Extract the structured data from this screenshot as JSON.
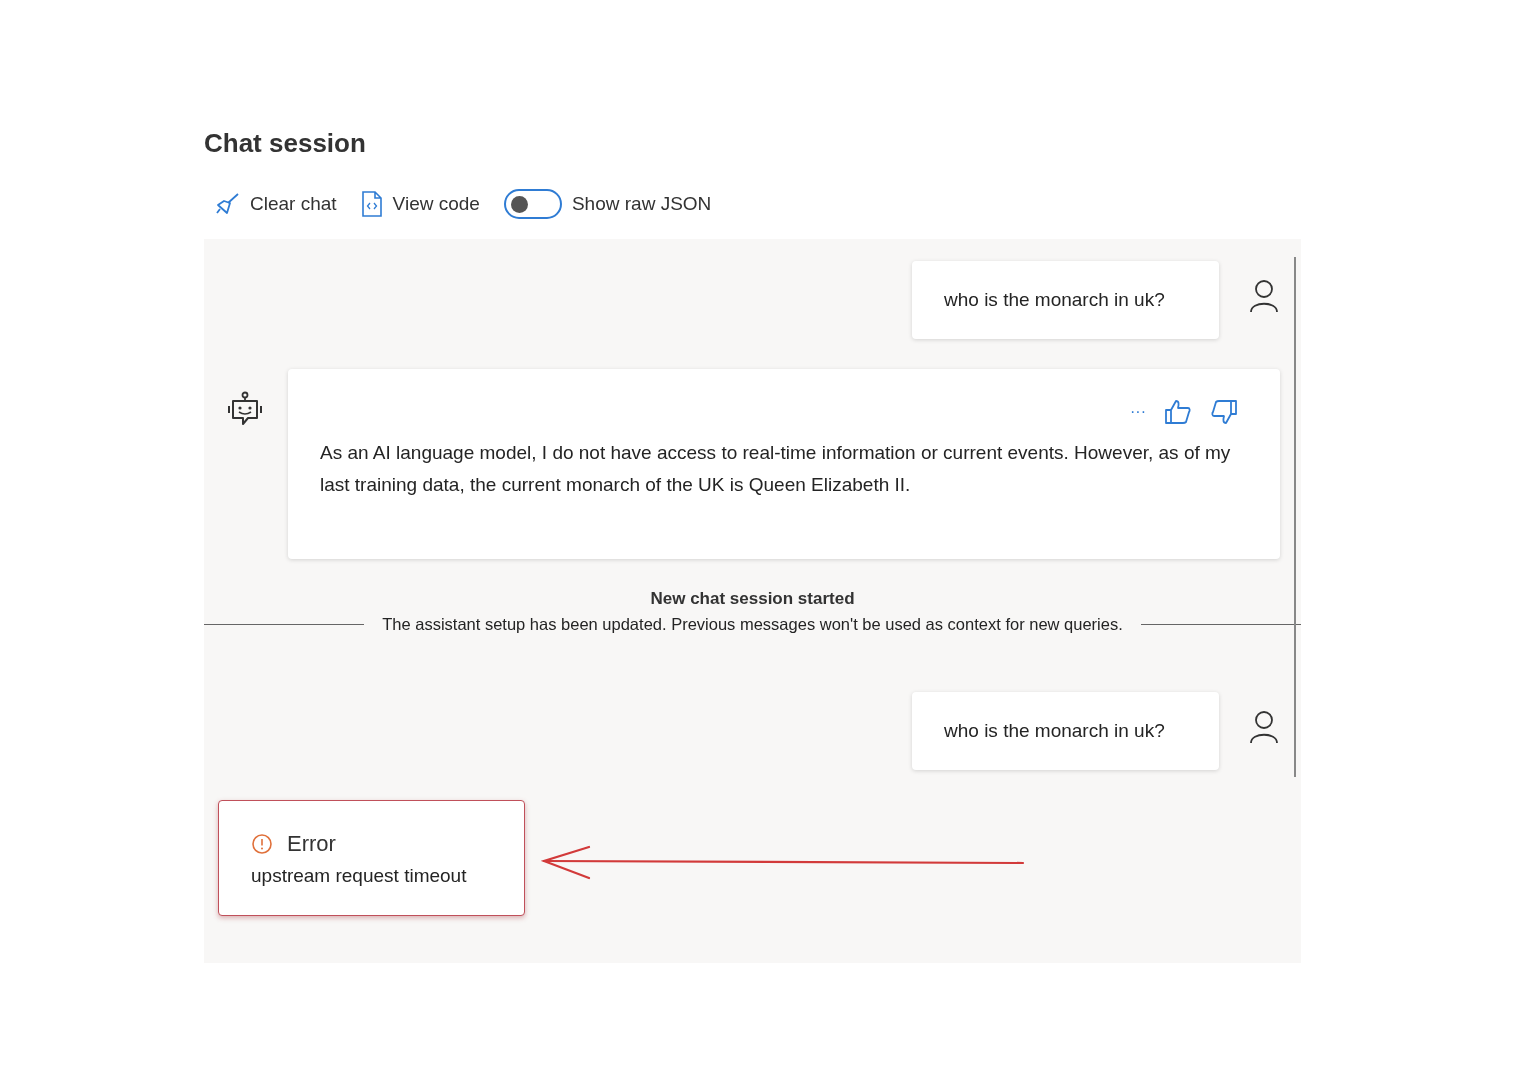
{
  "title": "Chat session",
  "toolbar": {
    "clear_label": "Clear chat",
    "view_code_label": "View code",
    "raw_json": {
      "label": "Show raw JSON",
      "on": false
    }
  },
  "messages": [
    {
      "kind": "user",
      "text": "who is the monarch in uk?"
    },
    {
      "kind": "assistant",
      "text": "As an AI language model, I do not have access to real-time information or current events. However, as of my last training data, the current monarch of the UK is Queen Elizabeth II.",
      "more": "···"
    },
    {
      "kind": "divider",
      "title": "New chat session started",
      "text": "The assistant setup has been updated. Previous messages won't be used as context for new queries."
    },
    {
      "kind": "user",
      "text": "who is the monarch in uk?"
    },
    {
      "kind": "error",
      "title": "Error",
      "text": "upstream request timeout"
    }
  ]
}
